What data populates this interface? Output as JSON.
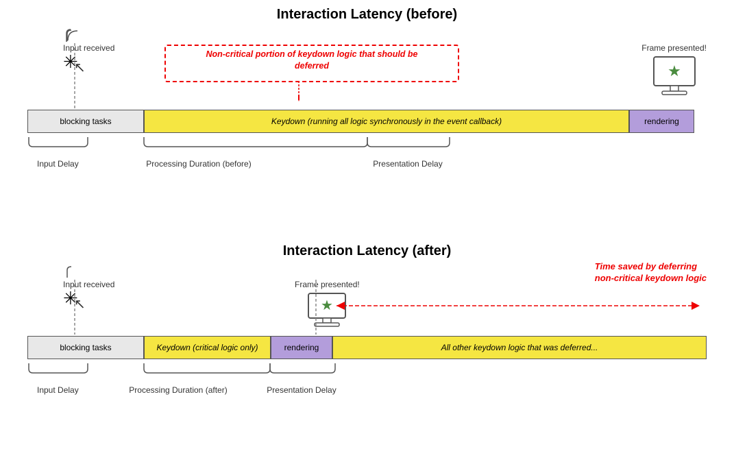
{
  "top": {
    "title": "Interaction Latency (before)",
    "input_received": "Input received",
    "frame_presented": "Frame presented!",
    "bar_blocking": "blocking tasks",
    "bar_keydown": "Keydown (running all logic synchronously in the event callback)",
    "bar_rendering": "rendering",
    "label_input_delay": "Input Delay",
    "label_processing": "Processing Duration (before)",
    "label_presentation": "Presentation Delay",
    "red_note": "Non-critical portion of keydown\nlogic that should be deferred"
  },
  "bottom": {
    "title": "Interaction Latency (after)",
    "input_received": "Input received",
    "frame_presented": "Frame presented!",
    "bar_blocking": "blocking tasks",
    "bar_keydown": "Keydown (critical logic only)",
    "bar_rendering": "rendering",
    "bar_deferred": "All other keydown logic that was deferred...",
    "label_input_delay": "Input Delay",
    "label_processing": "Processing Duration (after)",
    "label_presentation": "Presentation Delay",
    "time_saved": "Time saved by deferring\nnon-critical keydown logic"
  }
}
